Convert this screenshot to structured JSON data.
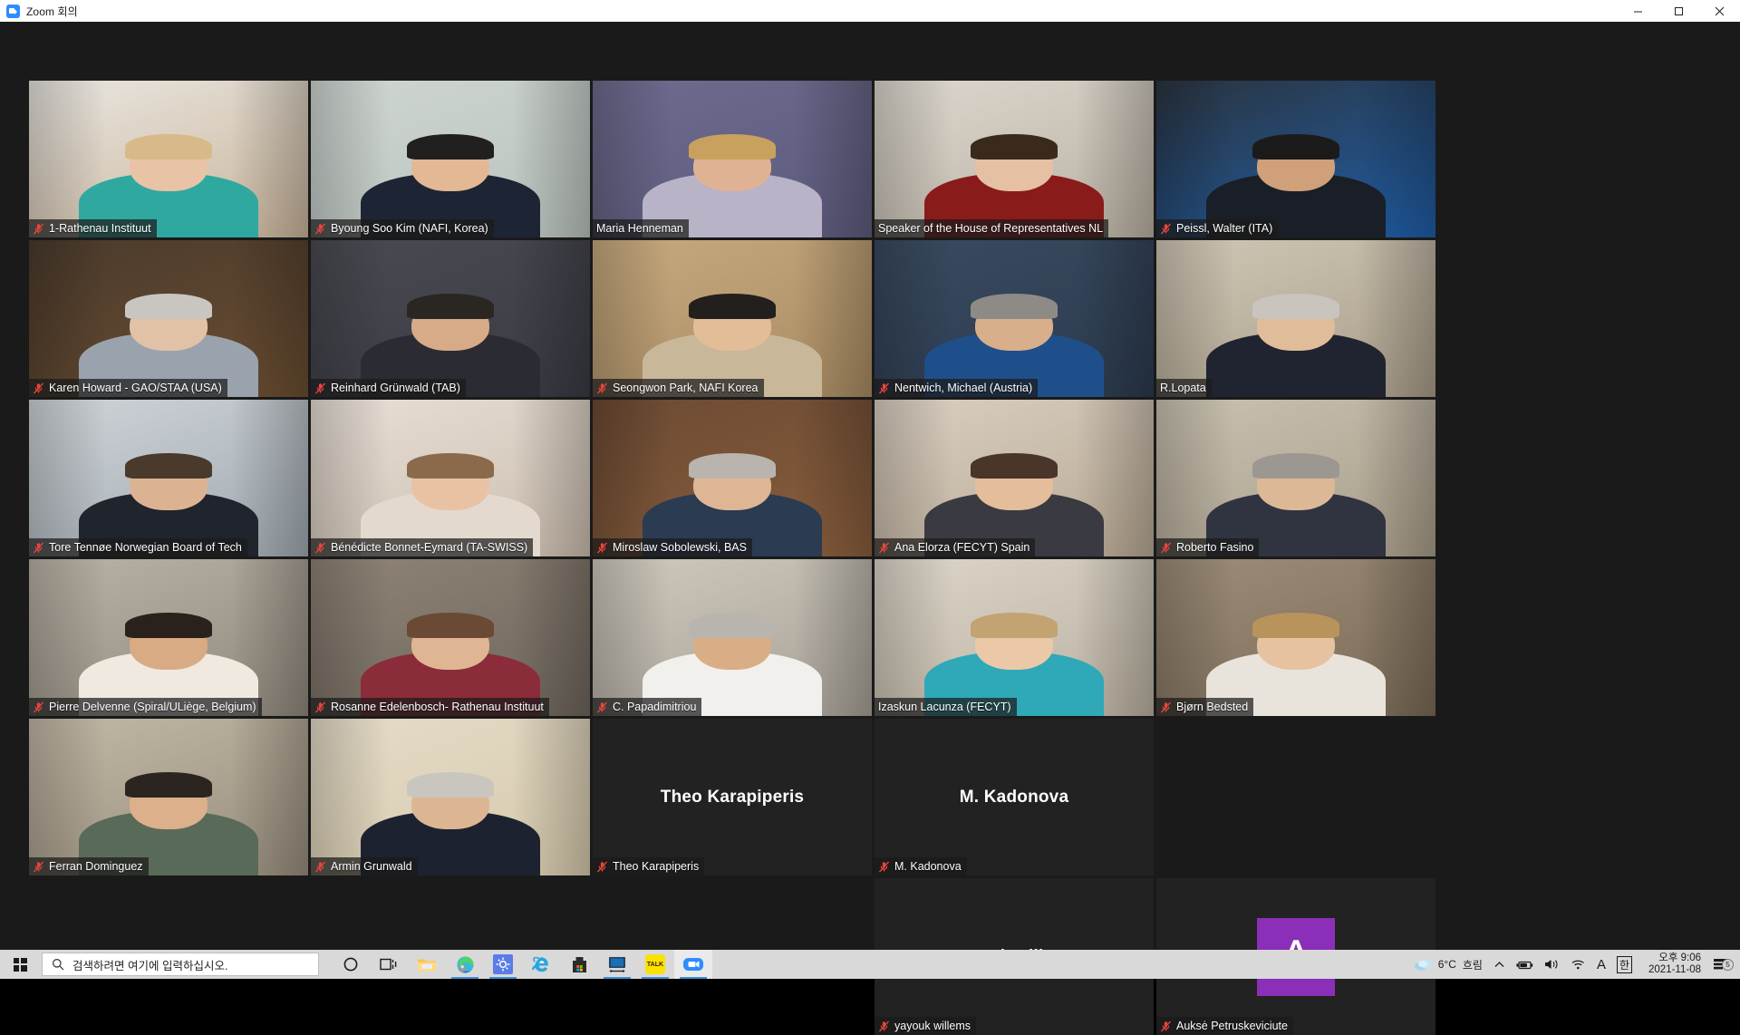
{
  "window": {
    "title": "Zoom 회의",
    "app_icon": "zoom-video-icon",
    "minimize": "–",
    "maximize": "❐",
    "close": "✕"
  },
  "meeting": {
    "active_speaker_border_color": "#a6e538",
    "background_color": "#1a1a1a",
    "tile_background_color": "#212121",
    "avatar_color": "#8b2fb8",
    "participants": [
      {
        "name": "1-Rathenau Instituut",
        "muted": true,
        "video": true,
        "active": false,
        "row": 1
      },
      {
        "name": "Byoung Soo Kim (NAFI, Korea)",
        "muted": true,
        "video": true,
        "active": false,
        "row": 1
      },
      {
        "name": "Maria Henneman",
        "muted": false,
        "video": true,
        "active": true,
        "row": 1
      },
      {
        "name": "Speaker of the House of Representatives NL",
        "muted": false,
        "video": true,
        "active": false,
        "row": 1
      },
      {
        "name": "Peissl, Walter (ITA)",
        "muted": true,
        "video": true,
        "active": false,
        "row": 1
      },
      {
        "name": "Karen Howard - GAO/STAA (USA)",
        "muted": true,
        "video": true,
        "active": false,
        "row": 1
      },
      {
        "name": "Reinhard Grünwald (TAB)",
        "muted": true,
        "video": true,
        "active": false,
        "row": 2
      },
      {
        "name": "Seongwon Park, NAFI Korea",
        "muted": true,
        "video": true,
        "active": false,
        "row": 2
      },
      {
        "name": "Nentwich, Michael (Austria)",
        "muted": true,
        "video": true,
        "active": false,
        "row": 2
      },
      {
        "name": "R.Lopata",
        "muted": false,
        "video": true,
        "active": false,
        "row": 2
      },
      {
        "name": "Tore Tennøe Norwegian Board of Tech",
        "muted": true,
        "video": true,
        "active": false,
        "row": 2
      },
      {
        "name": "Bénédicte Bonnet-Eymard (TA-SWISS)",
        "muted": true,
        "video": true,
        "active": false,
        "row": 2
      },
      {
        "name": "Miroslaw Sobolewski, BAS",
        "muted": true,
        "video": true,
        "active": false,
        "row": 3
      },
      {
        "name": "Ana Elorza (FECYT) Spain",
        "muted": true,
        "video": true,
        "active": false,
        "row": 3
      },
      {
        "name": "Roberto Fasino",
        "muted": true,
        "video": true,
        "active": false,
        "row": 3
      },
      {
        "name": "Pierre Delvenne (Spiral/ULiège, Belgium)",
        "muted": true,
        "video": true,
        "active": false,
        "row": 3
      },
      {
        "name": "Rosanne Edelenbosch- Rathenau Instituut",
        "muted": true,
        "video": true,
        "active": false,
        "row": 3
      },
      {
        "name": "C. Papadimitriou",
        "muted": true,
        "video": true,
        "active": false,
        "row": 3
      },
      {
        "name": "Izaskun Lacunza (FECYT)",
        "muted": false,
        "video": true,
        "active": false,
        "row": 4
      },
      {
        "name": "Bjørn Bedsted",
        "muted": true,
        "video": true,
        "active": false,
        "row": 4
      },
      {
        "name": "Ferran Dominguez",
        "muted": true,
        "video": true,
        "active": false,
        "row": 4
      },
      {
        "name": "Armin Grunwald",
        "muted": true,
        "video": true,
        "active": false,
        "row": 4
      },
      {
        "name": "Theo Karapiperis",
        "muted": true,
        "video": false,
        "display_name": "Theo Karapiperis",
        "active": false,
        "row": 4
      },
      {
        "name": "M. Kadonova",
        "muted": true,
        "video": false,
        "display_name": "M. Kadonova",
        "active": false,
        "row": 4
      },
      {
        "name": "yayouk willems",
        "muted": true,
        "video": false,
        "display_name": "yayouk willems",
        "active": false,
        "row": 5
      },
      {
        "name": "Auksė Petruskeviciute",
        "muted": true,
        "video": false,
        "avatar_initial": "A",
        "active": false,
        "row": 5
      }
    ]
  },
  "taskbar": {
    "start_icon": "windows-logo-icon",
    "search": {
      "placeholder": "검색하려면 여기에 입력하십시오.",
      "icon": "search-icon"
    },
    "apps": [
      {
        "name": "cortana-icon",
        "label": "Cortana"
      },
      {
        "name": "task-view-icon",
        "label": "작업 보기"
      },
      {
        "name": "file-explorer-icon",
        "label": "파일 탐색기"
      },
      {
        "name": "microsoft-edge-icon",
        "label": "Microsoft Edge"
      },
      {
        "name": "settings-icon",
        "label": "설정"
      },
      {
        "name": "internet-explorer-icon",
        "label": "Internet Explorer"
      },
      {
        "name": "microsoft-store-icon",
        "label": "Microsoft Store"
      },
      {
        "name": "display-app-icon",
        "label": "Display"
      },
      {
        "name": "kakaotalk-icon",
        "label": "TALK"
      },
      {
        "name": "zoom-icon",
        "label": "Zoom"
      }
    ],
    "tray": {
      "weather_icon": "cloud-icon",
      "temperature": "6°C",
      "condition": "흐림",
      "chevron": "∧",
      "battery_icon": "battery-icon",
      "volume_icon": "speaker-icon",
      "network_icon": "wifi-icon",
      "ime_a": "A",
      "ime_korean": "한",
      "time": "오후 9:06",
      "date": "2021-11-08",
      "notification_icon": "notification-icon",
      "notification_count": "5"
    }
  }
}
